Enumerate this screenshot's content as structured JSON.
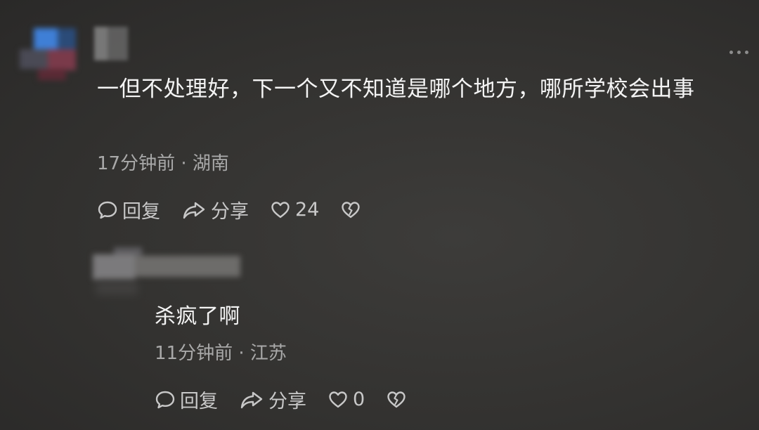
{
  "comments": [
    {
      "text": "一但不处理好，下一个又不知道是哪个地方，哪所学校会出事",
      "time": "17分钟前",
      "location": "湖南",
      "actions": {
        "reply_label": "回复",
        "share_label": "分享",
        "like_count": "24"
      }
    },
    {
      "text": "杀疯了啊",
      "time": "11分钟前",
      "location": "江苏",
      "actions": {
        "reply_label": "回复",
        "share_label": "分享",
        "like_count": "0"
      }
    }
  ],
  "icons": {
    "reply": "comment-bubble-icon",
    "share": "share-arrow-icon",
    "like": "heart-icon",
    "dislike": "broken-heart-icon",
    "more": "more-dots-icon"
  },
  "colors": {
    "background": "#333230",
    "text_primary": "#f4f4f4",
    "text_meta": "#a9a9a9",
    "action_text": "#c8c8c8"
  }
}
